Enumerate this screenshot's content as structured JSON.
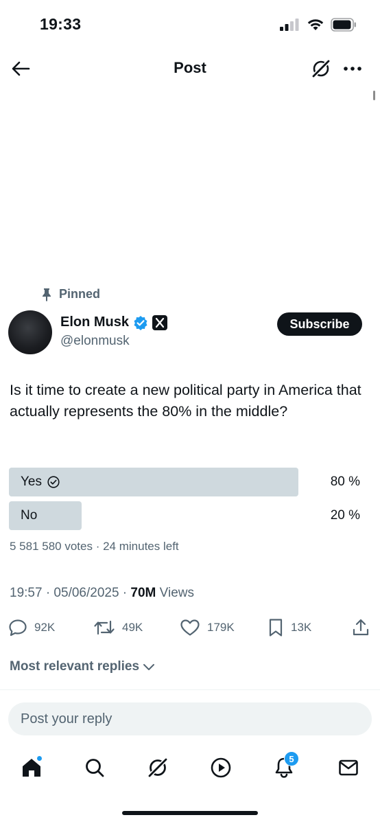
{
  "status_bar": {
    "time": "19:33"
  },
  "header": {
    "title": "Post"
  },
  "post": {
    "pinned_label": "Pinned",
    "author": {
      "name": "Elon Musk",
      "handle": "@elonmusk"
    },
    "subscribe_label": "Subscribe",
    "text": "Is it time to create a new political party in America that actually represents the 80% in the middle?",
    "poll": {
      "options": [
        {
          "label": "Yes",
          "percent_text": "80 %",
          "percent": 80,
          "selected": true
        },
        {
          "label": "No",
          "percent_text": "20 %",
          "percent": 20,
          "selected": false
        }
      ],
      "meta": "5 581 580 votes · 24 minutes left"
    },
    "timestamp": "19:57 · 05/06/2025 · ",
    "views_count": "70M",
    "views_label": " Views",
    "actions": {
      "replies": "92K",
      "reposts": "49K",
      "likes": "179K",
      "bookmarks": "13K"
    }
  },
  "replies_filter": {
    "label": "Most relevant replies"
  },
  "reply_input": {
    "placeholder": "Post your reply"
  },
  "bottom_nav": {
    "notifications_badge": "5"
  },
  "colors": {
    "text": "#0f1419",
    "muted": "#536471",
    "poll_bar": "#cfd9de",
    "accent": "#1d9bf0"
  }
}
